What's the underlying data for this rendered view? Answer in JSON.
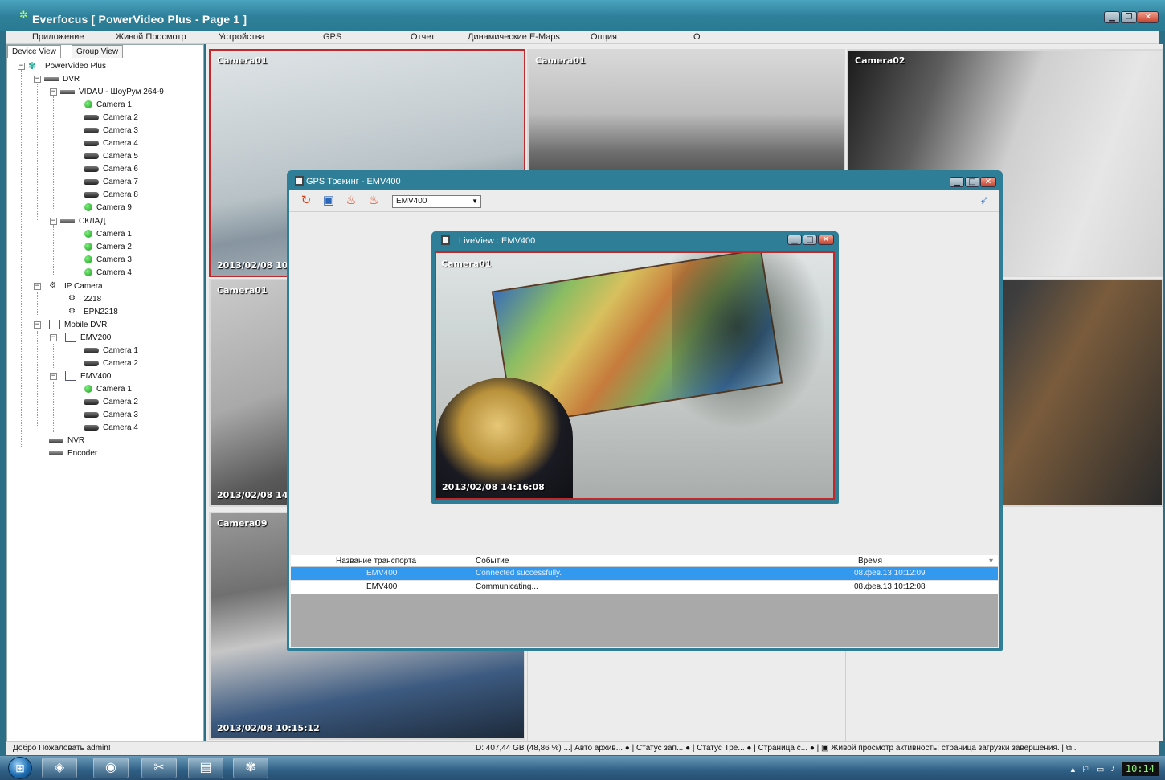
{
  "window": {
    "title": "Everfocus  [ PowerVideo Plus - Page 1 ]"
  },
  "menu": [
    "Приложение",
    "Живой Просмотр",
    "Устройства",
    "GPS",
    "Отчет",
    "Динамические E-Maps",
    "Опция",
    "О"
  ],
  "left_tabs": [
    "Device View",
    "Group View"
  ],
  "tree": [
    {
      "label": "PowerVideo Plus"
    },
    {
      "label": "DVR"
    },
    {
      "label": "VIDAU - ШоуРум 264-9"
    },
    {
      "label": "Camera 1"
    },
    {
      "label": "Camera 2"
    },
    {
      "label": "Camera 3"
    },
    {
      "label": "Camera 4"
    },
    {
      "label": "Camera 5"
    },
    {
      "label": "Camera 6"
    },
    {
      "label": "Camera 7"
    },
    {
      "label": "Camera 8"
    },
    {
      "label": "Camera 9"
    },
    {
      "label": "СКЛАД"
    },
    {
      "label": "Camera 1"
    },
    {
      "label": "Camera 2"
    },
    {
      "label": "Camera 3"
    },
    {
      "label": "Camera 4"
    },
    {
      "label": "IP Camera"
    },
    {
      "label": "2218"
    },
    {
      "label": "EPN2218"
    },
    {
      "label": "Mobile DVR"
    },
    {
      "label": "EMV200"
    },
    {
      "label": "Camera 1"
    },
    {
      "label": "Camera 2"
    },
    {
      "label": "EMV400"
    },
    {
      "label": "Camera 1"
    },
    {
      "label": "Camera 2"
    },
    {
      "label": "Camera 3"
    },
    {
      "label": "Camera 4"
    },
    {
      "label": "NVR"
    },
    {
      "label": "Encoder"
    }
  ],
  "tiles": [
    {
      "label": "Camera01",
      "timestamp": "2013/02/08  10:"
    },
    {
      "label": "Camera01",
      "timestamp": ""
    },
    {
      "label": "Camera02",
      "timestamp": ""
    },
    {
      "label": "Camera01",
      "timestamp": "2013/02/08  14:"
    },
    {
      "label": "",
      "timestamp": ""
    },
    {
      "label": "Camera09",
      "timestamp": "2013/02/08  10:15:12"
    }
  ],
  "gps": {
    "title": "GPS Трекинг - EMV400",
    "vehicle": "EMV400",
    "liveview": {
      "title": "LiveView : EMV400",
      "camera": "Camera01",
      "timestamp": "2013/02/08  14:16:08"
    },
    "table": {
      "headers": [
        "Название транспорта",
        "Событие",
        "Время"
      ],
      "rows": [
        [
          "EMV400",
          "Connected successfully.",
          "08.фев.13 10:12:09"
        ],
        [
          "EMV400",
          "Communicating...",
          "08.фев.13 10:12:08"
        ]
      ]
    }
  },
  "status": {
    "welcome": "Добро Пожаловать admin!",
    "text": "D: 407,44 GB (48,86 %) ...| Авто архив... ● | Статус зап... ● | Статус Тре... ● | Страница с... ● | ▣ Живой просмотр активность: страница загрузки завершения. | ⧉ ."
  },
  "taskbar": {
    "clock": "10:14"
  },
  "colors": {
    "title_bar": "#2e7f99",
    "selected_border": "#c0292b",
    "selected_row": "#3399ee"
  }
}
